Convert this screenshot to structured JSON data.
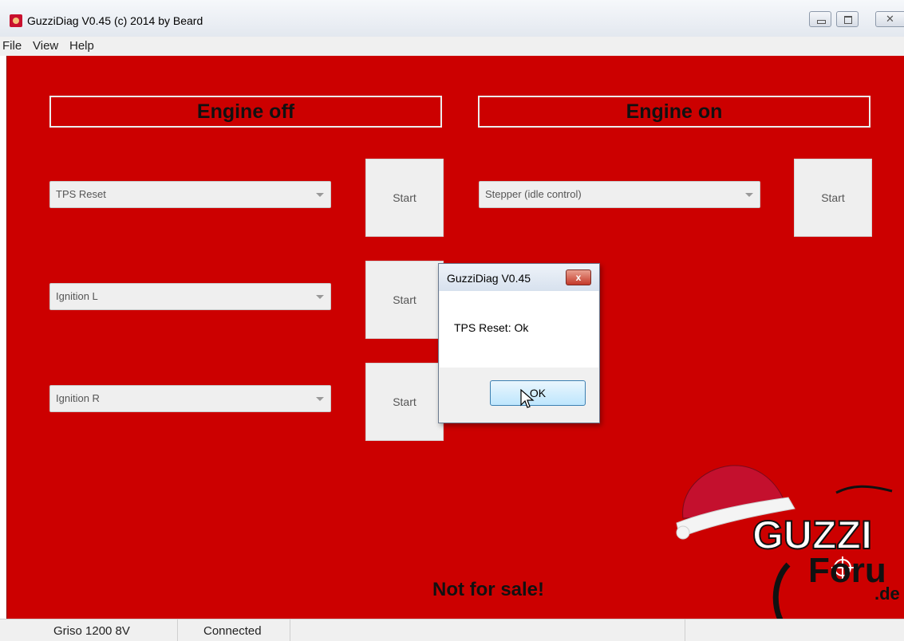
{
  "window": {
    "title": "GuzziDiag V0.45  (c) 2014 by Beard",
    "icon": "app-icon"
  },
  "menu": [
    "File",
    "View",
    "Help"
  ],
  "engine_off": {
    "title": "Engine off",
    "rows": [
      {
        "select": "TPS Reset",
        "button": "Start"
      },
      {
        "select": "Ignition L",
        "button": "Start"
      },
      {
        "select": "Ignition R",
        "button": "Start"
      }
    ]
  },
  "engine_on": {
    "title": "Engine on",
    "rows": [
      {
        "select": "Stepper (idle control)",
        "button": "Start"
      }
    ]
  },
  "footer_text": "Not for sale!",
  "logo": {
    "line1": "GUZZI",
    "line2": "Foru",
    "line3": ".de"
  },
  "dialog": {
    "title": "GuzziDiag V0.45",
    "close_label": "x",
    "message": "TPS Reset: Ok",
    "ok_label": "OK"
  },
  "status": {
    "model": "Griso 1200 8V",
    "connection": "Connected"
  },
  "colors": {
    "background": "#cc0000",
    "panel": "#efefef"
  }
}
